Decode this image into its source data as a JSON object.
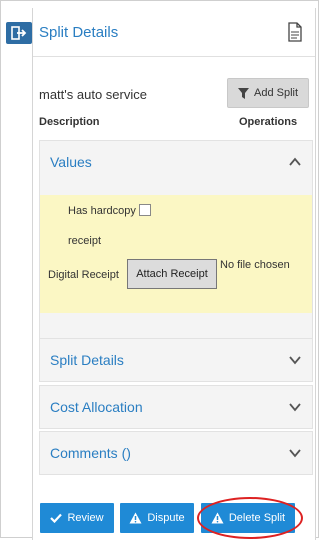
{
  "panel": {
    "title": "Split Details"
  },
  "split": {
    "merchant": "matt's auto service",
    "add_split_label": "Add Split",
    "description_label": "Description",
    "operations_label": "Operations"
  },
  "values_section": {
    "title": "Values",
    "expanded": true,
    "has_hardcopy_label": "Has hardcopy",
    "receipt_label": "receipt",
    "has_hardcopy_checked": false,
    "digital_receipt_label": "Digital Receipt",
    "attach_receipt_label": "Attach Receipt",
    "no_file_label": "No file chosen"
  },
  "sections": [
    {
      "title": "Split Details",
      "expanded": false
    },
    {
      "title": "Cost Allocation",
      "expanded": false
    },
    {
      "title": "Comments ()",
      "expanded": false
    }
  ],
  "actions": {
    "review_label": "Review",
    "dispute_label": "Dispute",
    "delete_label": "Delete Split"
  },
  "colors": {
    "accent": "#2a7ec2",
    "button": "#1f8ad6",
    "values_body": "#fbf7c4",
    "highlight": "#dd2222"
  },
  "icons": [
    "exit-icon",
    "document-icon",
    "filter-icon",
    "chevron-up-icon",
    "chevron-down-icon",
    "checkmark-icon",
    "warning-icon"
  ]
}
